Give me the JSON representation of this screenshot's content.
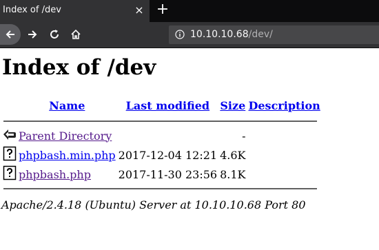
{
  "browser": {
    "tab_title": "Index of /dev",
    "close_tab_label": "×",
    "new_tab_label": "+",
    "url_host": "10.10.10.68",
    "url_path": "/dev/"
  },
  "page": {
    "heading": "Index of /dev",
    "columns": {
      "name": "Name",
      "last_modified": "Last modified",
      "size": "Size",
      "description": "Description"
    },
    "parent": {
      "label": "Parent Directory",
      "size": "-"
    },
    "files": [
      {
        "name": "phpbash.min.php",
        "modified": "2017-12-04 12:21",
        "size": "4.6K"
      },
      {
        "name": "phpbash.php",
        "modified": "2017-11-30 23:56",
        "size": "8.1K"
      }
    ],
    "footer": "Apache/2.4.18 (Ubuntu) Server at 10.10.10.68 Port 80"
  }
}
